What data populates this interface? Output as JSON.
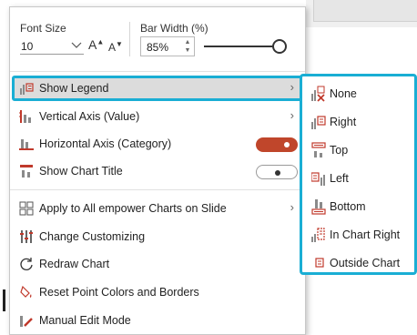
{
  "toolbar": {
    "font_size_label": "Font Size",
    "font_size_value": "10",
    "grow_font_label": "A",
    "shrink_font_label": "A",
    "bar_width_label": "Bar Width (%)",
    "bar_width_value": "85%",
    "bar_width_slider_level": 0.95
  },
  "menu": {
    "items": [
      {
        "label": "Show Legend",
        "icon": "legend-icon",
        "has_submenu": true,
        "highlighted": true
      },
      {
        "label": "Vertical Axis (Value)",
        "icon": "vertical-axis-icon",
        "has_submenu": true
      },
      {
        "label": "Horizontal Axis (Category)",
        "icon": "horizontal-axis-icon",
        "toggle": "on"
      },
      {
        "label": "Show Chart Title",
        "icon": "chart-title-icon",
        "toggle": "off"
      },
      {
        "label": "Apply to All empower Charts on Slide",
        "icon": "grid-icon",
        "has_submenu": true
      },
      {
        "label": "Change Customizing",
        "icon": "customizing-icon"
      },
      {
        "label": "Redraw Chart",
        "icon": "redraw-icon"
      },
      {
        "label": "Reset Point Colors and Borders",
        "icon": "reset-colors-icon"
      },
      {
        "label": "Manual Edit Mode",
        "icon": "manual-edit-icon"
      }
    ],
    "arrow": "›"
  },
  "legend_submenu": {
    "items": [
      {
        "label": "None",
        "icon": "legend-none-icon"
      },
      {
        "label": "Right",
        "icon": "legend-right-icon"
      },
      {
        "label": "Top",
        "icon": "legend-top-icon"
      },
      {
        "label": "Left",
        "icon": "legend-left-icon"
      },
      {
        "label": "Bottom",
        "icon": "legend-bottom-icon"
      },
      {
        "label": "In Chart Right",
        "icon": "legend-in-chart-right-icon"
      },
      {
        "label": "Outside Chart",
        "icon": "legend-outside-chart-icon"
      }
    ]
  },
  "colors": {
    "accent_outline": "#1aaed4",
    "toggle_on": "#c0462b",
    "icon_red": "#c0392b",
    "icon_gray": "#8a8a8a"
  }
}
